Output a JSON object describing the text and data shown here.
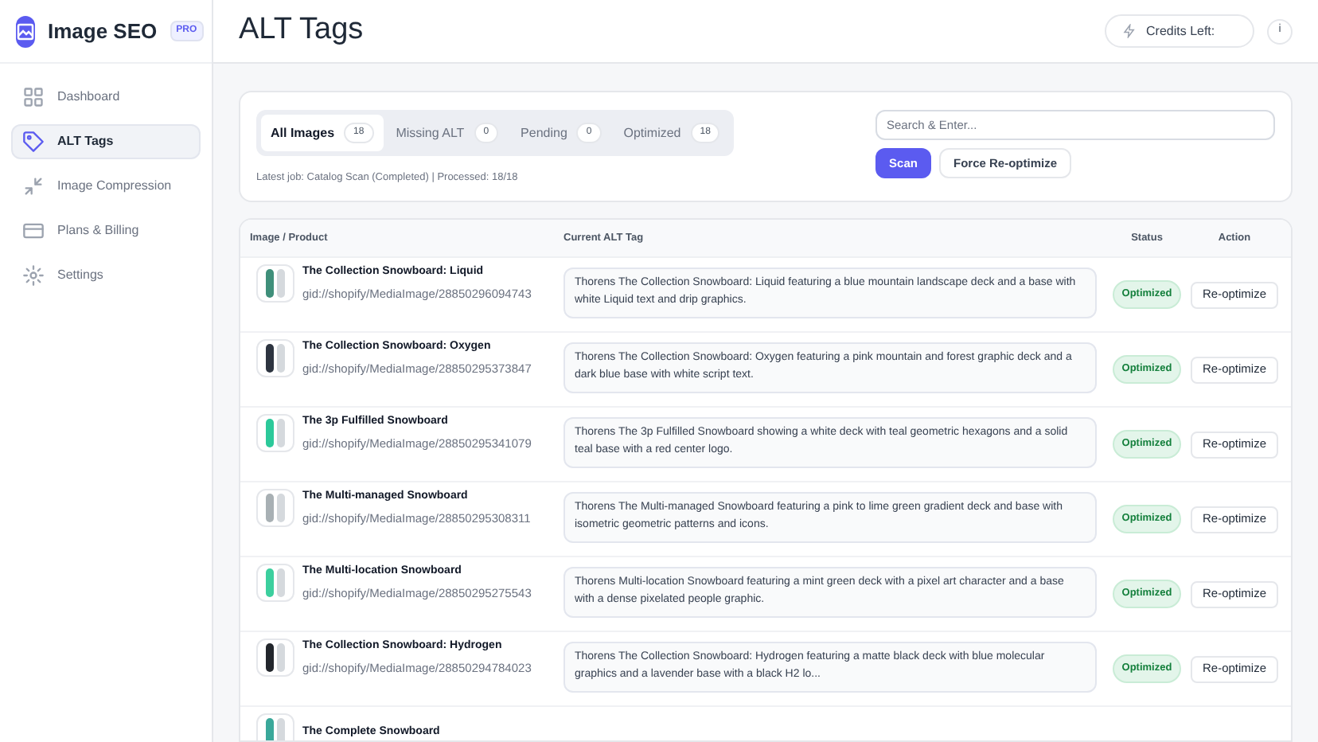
{
  "brand": {
    "name": "Image SEO",
    "badge": "PRO"
  },
  "sidebar": {
    "items": [
      {
        "label": "Dashboard",
        "selected": false
      },
      {
        "label": "ALT Tags",
        "selected": true
      },
      {
        "label": "Image Compression",
        "selected": false
      },
      {
        "label": "Plans & Billing",
        "selected": false
      },
      {
        "label": "Settings",
        "selected": false
      }
    ]
  },
  "header": {
    "title": "ALT Tags",
    "credits": "Credits Left:",
    "info": "i"
  },
  "filters": {
    "tabs": [
      {
        "label": "All Images",
        "count": "18",
        "selected": true
      },
      {
        "label": "Missing ALT",
        "count": "0",
        "selected": false
      },
      {
        "label": "Pending",
        "count": "0",
        "selected": false
      },
      {
        "label": "Optimized",
        "count": "18",
        "selected": false
      }
    ],
    "job": "Latest job: Catalog Scan (Completed) | Processed: 18/18",
    "search": {
      "placeholder": "Search & Enter..."
    },
    "buttons": [
      {
        "label": "Scan",
        "kind": "primary"
      },
      {
        "label": "Force Re-optimize",
        "kind": "secondary"
      }
    ]
  },
  "table": {
    "columns": [
      "Image / Product",
      "Current ALT Tag",
      "Status",
      "Action"
    ],
    "rows": [
      {
        "name": "The Collection Snowboard: Liquid",
        "gid": "gid://shopify/MediaImage/28850296094743",
        "alt": "Thorens The Collection Snowboard: Liquid featuring a blue mountain landscape deck and a base with white Liquid text and drip graphics.",
        "status": "Optimized",
        "action": "Re-optimize",
        "color": "#3f8f7a"
      },
      {
        "name": "The Collection Snowboard: Oxygen",
        "gid": "gid://shopify/MediaImage/28850295373847",
        "alt": "Thorens The Collection Snowboard: Oxygen featuring a pink mountain and forest graphic deck and a dark blue base with white script text.",
        "status": "Optimized",
        "action": "Re-optimize",
        "color": "#2d3440"
      },
      {
        "name": "The 3p Fulfilled Snowboard",
        "gid": "gid://shopify/MediaImage/28850295341079",
        "alt": "Thorens The 3p Fulfilled Snowboard showing a white deck with teal geometric hexagons and a solid teal base with a red center logo.",
        "status": "Optimized",
        "action": "Re-optimize",
        "color": "#2cc99a"
      },
      {
        "name": "The Multi-managed Snowboard",
        "gid": "gid://shopify/MediaImage/28850295308311",
        "alt": "Thorens The Multi-managed Snowboard featuring a pink to lime green gradient deck and base with isometric geometric patterns and icons.",
        "status": "Optimized",
        "action": "Re-optimize",
        "color": "#a8b0b4"
      },
      {
        "name": "The Multi-location Snowboard",
        "gid": "gid://shopify/MediaImage/28850295275543",
        "alt": "Thorens Multi-location Snowboard featuring a mint green deck with a pixel art character and a base with a dense pixelated people graphic.",
        "status": "Optimized",
        "action": "Re-optimize",
        "color": "#3ccf9e"
      },
      {
        "name": "The Collection Snowboard: Hydrogen",
        "gid": "gid://shopify/MediaImage/28850294784023",
        "alt": "Thorens The Collection Snowboard: Hydrogen featuring a matte black deck with blue molecular graphics and a lavender base with a black H2 lo...",
        "status": "Optimized",
        "action": "Re-optimize",
        "color": "#22262c"
      },
      {
        "name": "The Complete Snowboard",
        "color": "#3aa89a"
      }
    ]
  }
}
